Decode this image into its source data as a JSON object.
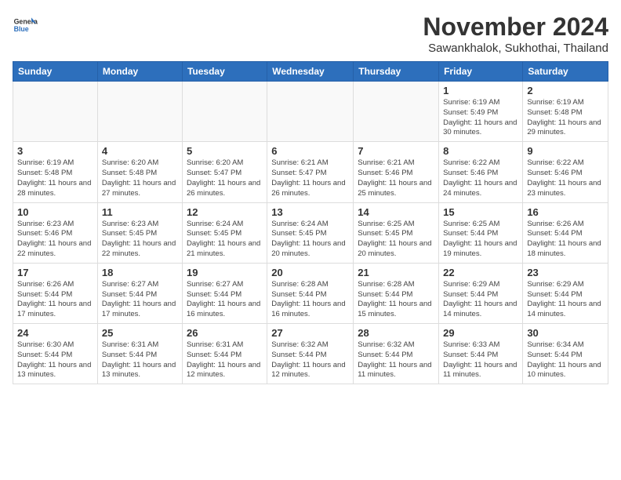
{
  "header": {
    "logo_line1": "General",
    "logo_line2": "Blue",
    "month": "November 2024",
    "location": "Sawankhalok, Sukhothai, Thailand"
  },
  "weekdays": [
    "Sunday",
    "Monday",
    "Tuesday",
    "Wednesday",
    "Thursday",
    "Friday",
    "Saturday"
  ],
  "weeks": [
    [
      {
        "day": "",
        "info": ""
      },
      {
        "day": "",
        "info": ""
      },
      {
        "day": "",
        "info": ""
      },
      {
        "day": "",
        "info": ""
      },
      {
        "day": "",
        "info": ""
      },
      {
        "day": "1",
        "info": "Sunrise: 6:19 AM\nSunset: 5:49 PM\nDaylight: 11 hours and 30 minutes."
      },
      {
        "day": "2",
        "info": "Sunrise: 6:19 AM\nSunset: 5:48 PM\nDaylight: 11 hours and 29 minutes."
      }
    ],
    [
      {
        "day": "3",
        "info": "Sunrise: 6:19 AM\nSunset: 5:48 PM\nDaylight: 11 hours and 28 minutes."
      },
      {
        "day": "4",
        "info": "Sunrise: 6:20 AM\nSunset: 5:48 PM\nDaylight: 11 hours and 27 minutes."
      },
      {
        "day": "5",
        "info": "Sunrise: 6:20 AM\nSunset: 5:47 PM\nDaylight: 11 hours and 26 minutes."
      },
      {
        "day": "6",
        "info": "Sunrise: 6:21 AM\nSunset: 5:47 PM\nDaylight: 11 hours and 26 minutes."
      },
      {
        "day": "7",
        "info": "Sunrise: 6:21 AM\nSunset: 5:46 PM\nDaylight: 11 hours and 25 minutes."
      },
      {
        "day": "8",
        "info": "Sunrise: 6:22 AM\nSunset: 5:46 PM\nDaylight: 11 hours and 24 minutes."
      },
      {
        "day": "9",
        "info": "Sunrise: 6:22 AM\nSunset: 5:46 PM\nDaylight: 11 hours and 23 minutes."
      }
    ],
    [
      {
        "day": "10",
        "info": "Sunrise: 6:23 AM\nSunset: 5:46 PM\nDaylight: 11 hours and 22 minutes."
      },
      {
        "day": "11",
        "info": "Sunrise: 6:23 AM\nSunset: 5:45 PM\nDaylight: 11 hours and 22 minutes."
      },
      {
        "day": "12",
        "info": "Sunrise: 6:24 AM\nSunset: 5:45 PM\nDaylight: 11 hours and 21 minutes."
      },
      {
        "day": "13",
        "info": "Sunrise: 6:24 AM\nSunset: 5:45 PM\nDaylight: 11 hours and 20 minutes."
      },
      {
        "day": "14",
        "info": "Sunrise: 6:25 AM\nSunset: 5:45 PM\nDaylight: 11 hours and 20 minutes."
      },
      {
        "day": "15",
        "info": "Sunrise: 6:25 AM\nSunset: 5:44 PM\nDaylight: 11 hours and 19 minutes."
      },
      {
        "day": "16",
        "info": "Sunrise: 6:26 AM\nSunset: 5:44 PM\nDaylight: 11 hours and 18 minutes."
      }
    ],
    [
      {
        "day": "17",
        "info": "Sunrise: 6:26 AM\nSunset: 5:44 PM\nDaylight: 11 hours and 17 minutes."
      },
      {
        "day": "18",
        "info": "Sunrise: 6:27 AM\nSunset: 5:44 PM\nDaylight: 11 hours and 17 minutes."
      },
      {
        "day": "19",
        "info": "Sunrise: 6:27 AM\nSunset: 5:44 PM\nDaylight: 11 hours and 16 minutes."
      },
      {
        "day": "20",
        "info": "Sunrise: 6:28 AM\nSunset: 5:44 PM\nDaylight: 11 hours and 16 minutes."
      },
      {
        "day": "21",
        "info": "Sunrise: 6:28 AM\nSunset: 5:44 PM\nDaylight: 11 hours and 15 minutes."
      },
      {
        "day": "22",
        "info": "Sunrise: 6:29 AM\nSunset: 5:44 PM\nDaylight: 11 hours and 14 minutes."
      },
      {
        "day": "23",
        "info": "Sunrise: 6:29 AM\nSunset: 5:44 PM\nDaylight: 11 hours and 14 minutes."
      }
    ],
    [
      {
        "day": "24",
        "info": "Sunrise: 6:30 AM\nSunset: 5:44 PM\nDaylight: 11 hours and 13 minutes."
      },
      {
        "day": "25",
        "info": "Sunrise: 6:31 AM\nSunset: 5:44 PM\nDaylight: 11 hours and 13 minutes."
      },
      {
        "day": "26",
        "info": "Sunrise: 6:31 AM\nSunset: 5:44 PM\nDaylight: 11 hours and 12 minutes."
      },
      {
        "day": "27",
        "info": "Sunrise: 6:32 AM\nSunset: 5:44 PM\nDaylight: 11 hours and 12 minutes."
      },
      {
        "day": "28",
        "info": "Sunrise: 6:32 AM\nSunset: 5:44 PM\nDaylight: 11 hours and 11 minutes."
      },
      {
        "day": "29",
        "info": "Sunrise: 6:33 AM\nSunset: 5:44 PM\nDaylight: 11 hours and 11 minutes."
      },
      {
        "day": "30",
        "info": "Sunrise: 6:34 AM\nSunset: 5:44 PM\nDaylight: 11 hours and 10 minutes."
      }
    ]
  ]
}
